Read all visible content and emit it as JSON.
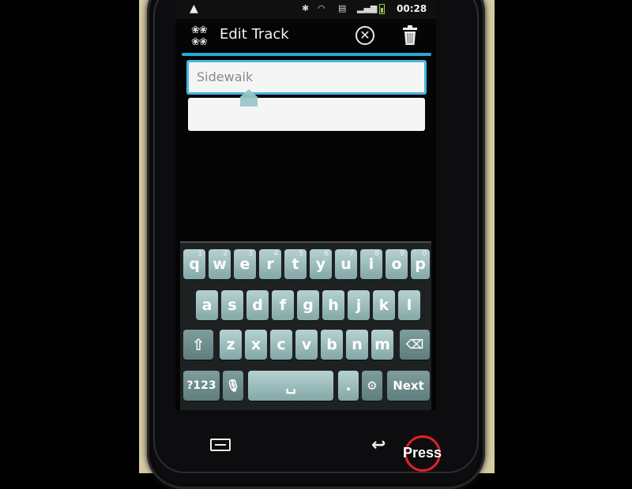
{
  "status_bar": {
    "warning_icon": "warning-icon",
    "icons": [
      "bluetooth-icon",
      "wifi-icon",
      "sim-icon",
      "signal-icon",
      "battery-icon"
    ],
    "time": "00:28"
  },
  "header": {
    "title": "Edit Track",
    "cancel_icon": "circle-x-icon",
    "delete_icon": "trash-icon",
    "accent_color": "#2aa6d6"
  },
  "form": {
    "name_value": "Sidewaik",
    "description_value": ""
  },
  "keyboard": {
    "row1": [
      {
        "label": "q",
        "sup": "1"
      },
      {
        "label": "w",
        "sup": "2"
      },
      {
        "label": "e",
        "sup": "3"
      },
      {
        "label": "r",
        "sup": "4"
      },
      {
        "label": "t",
        "sup": "5"
      },
      {
        "label": "y",
        "sup": "6"
      },
      {
        "label": "u",
        "sup": "7"
      },
      {
        "label": "i",
        "sup": "8"
      },
      {
        "label": "o",
        "sup": "9"
      },
      {
        "label": "p",
        "sup": "0"
      }
    ],
    "row2": [
      "a",
      "s",
      "d",
      "f",
      "g",
      "h",
      "j",
      "k",
      "l"
    ],
    "row3": [
      "z",
      "x",
      "c",
      "v",
      "b",
      "n",
      "m"
    ],
    "symbols_label": "?123",
    "next_label": "Next",
    "period_label": "."
  },
  "nav": {
    "menu_icon": "menu-icon",
    "back_icon": "back-icon",
    "overlay_text": "Press",
    "overlay_color": "#e1202a"
  }
}
